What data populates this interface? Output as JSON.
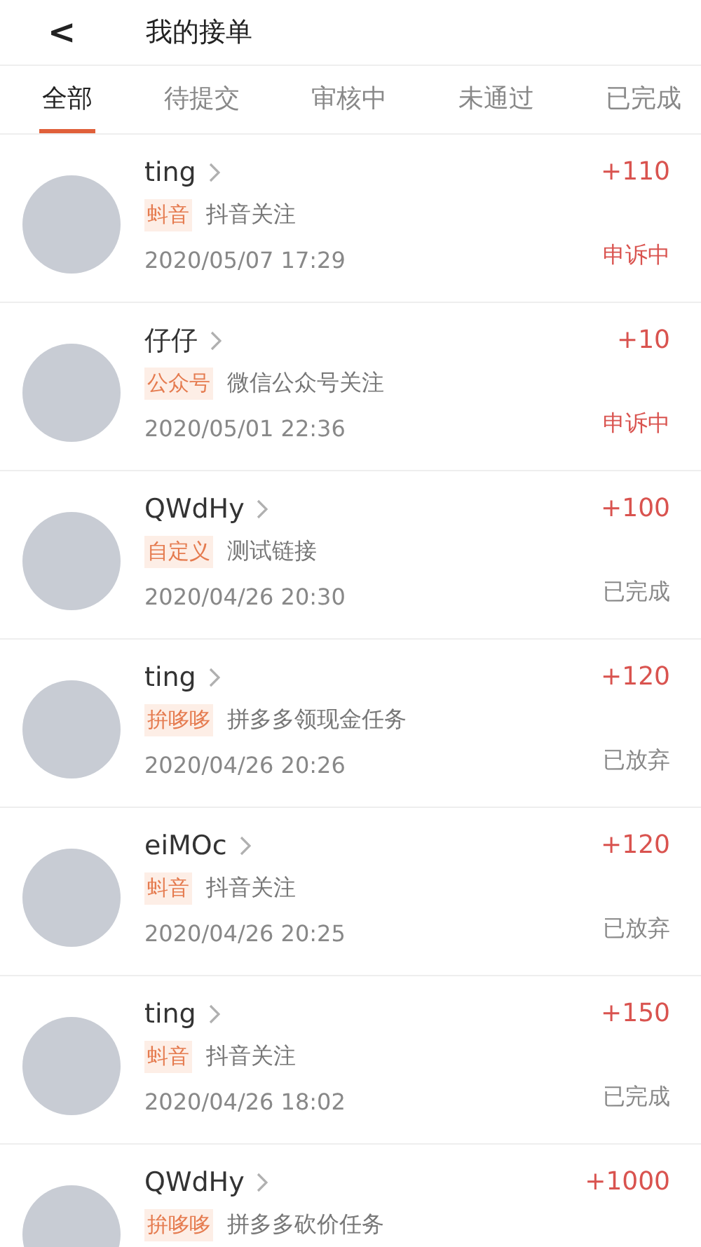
{
  "header": {
    "back": "<",
    "title": "我的接单"
  },
  "tabs": [
    {
      "label": "全部",
      "selected": true
    },
    {
      "label": "待提交",
      "selected": false
    },
    {
      "label": "审核中",
      "selected": false
    },
    {
      "label": "未通过",
      "selected": false
    },
    {
      "label": "已完成",
      "selected": false
    }
  ],
  "orders": [
    {
      "user": "ting",
      "tag": "蚪音",
      "task": "抖音关注",
      "time": "2020/05/07 17:29",
      "reward": "+110",
      "status": "申诉中",
      "alert": true
    },
    {
      "user": "仔仔",
      "tag": "公众号",
      "task": "微信公众号关注",
      "time": "2020/05/01 22:36",
      "reward": "+10",
      "status": "申诉中",
      "alert": true
    },
    {
      "user": "QWdHy",
      "tag": "自定义",
      "task": "测试链接",
      "time": "2020/04/26 20:30",
      "reward": "+100",
      "status": "已完成",
      "alert": false
    },
    {
      "user": "ting",
      "tag": "拚哆哆",
      "task": "拼多多领现金任务",
      "time": "2020/04/26 20:26",
      "reward": "+120",
      "status": "已放弃",
      "alert": false
    },
    {
      "user": "eiMOc",
      "tag": "蚪音",
      "task": "抖音关注",
      "time": "2020/04/26 20:25",
      "reward": "+120",
      "status": "已放弃",
      "alert": false
    },
    {
      "user": "ting",
      "tag": "蚪音",
      "task": "抖音关注",
      "time": "2020/04/26 18:02",
      "reward": "+150",
      "status": "已完成",
      "alert": false
    },
    {
      "user": "QWdHy",
      "tag": "拚哆哆",
      "task": "拼多多砍价任务",
      "reward": "+1000"
    }
  ]
}
